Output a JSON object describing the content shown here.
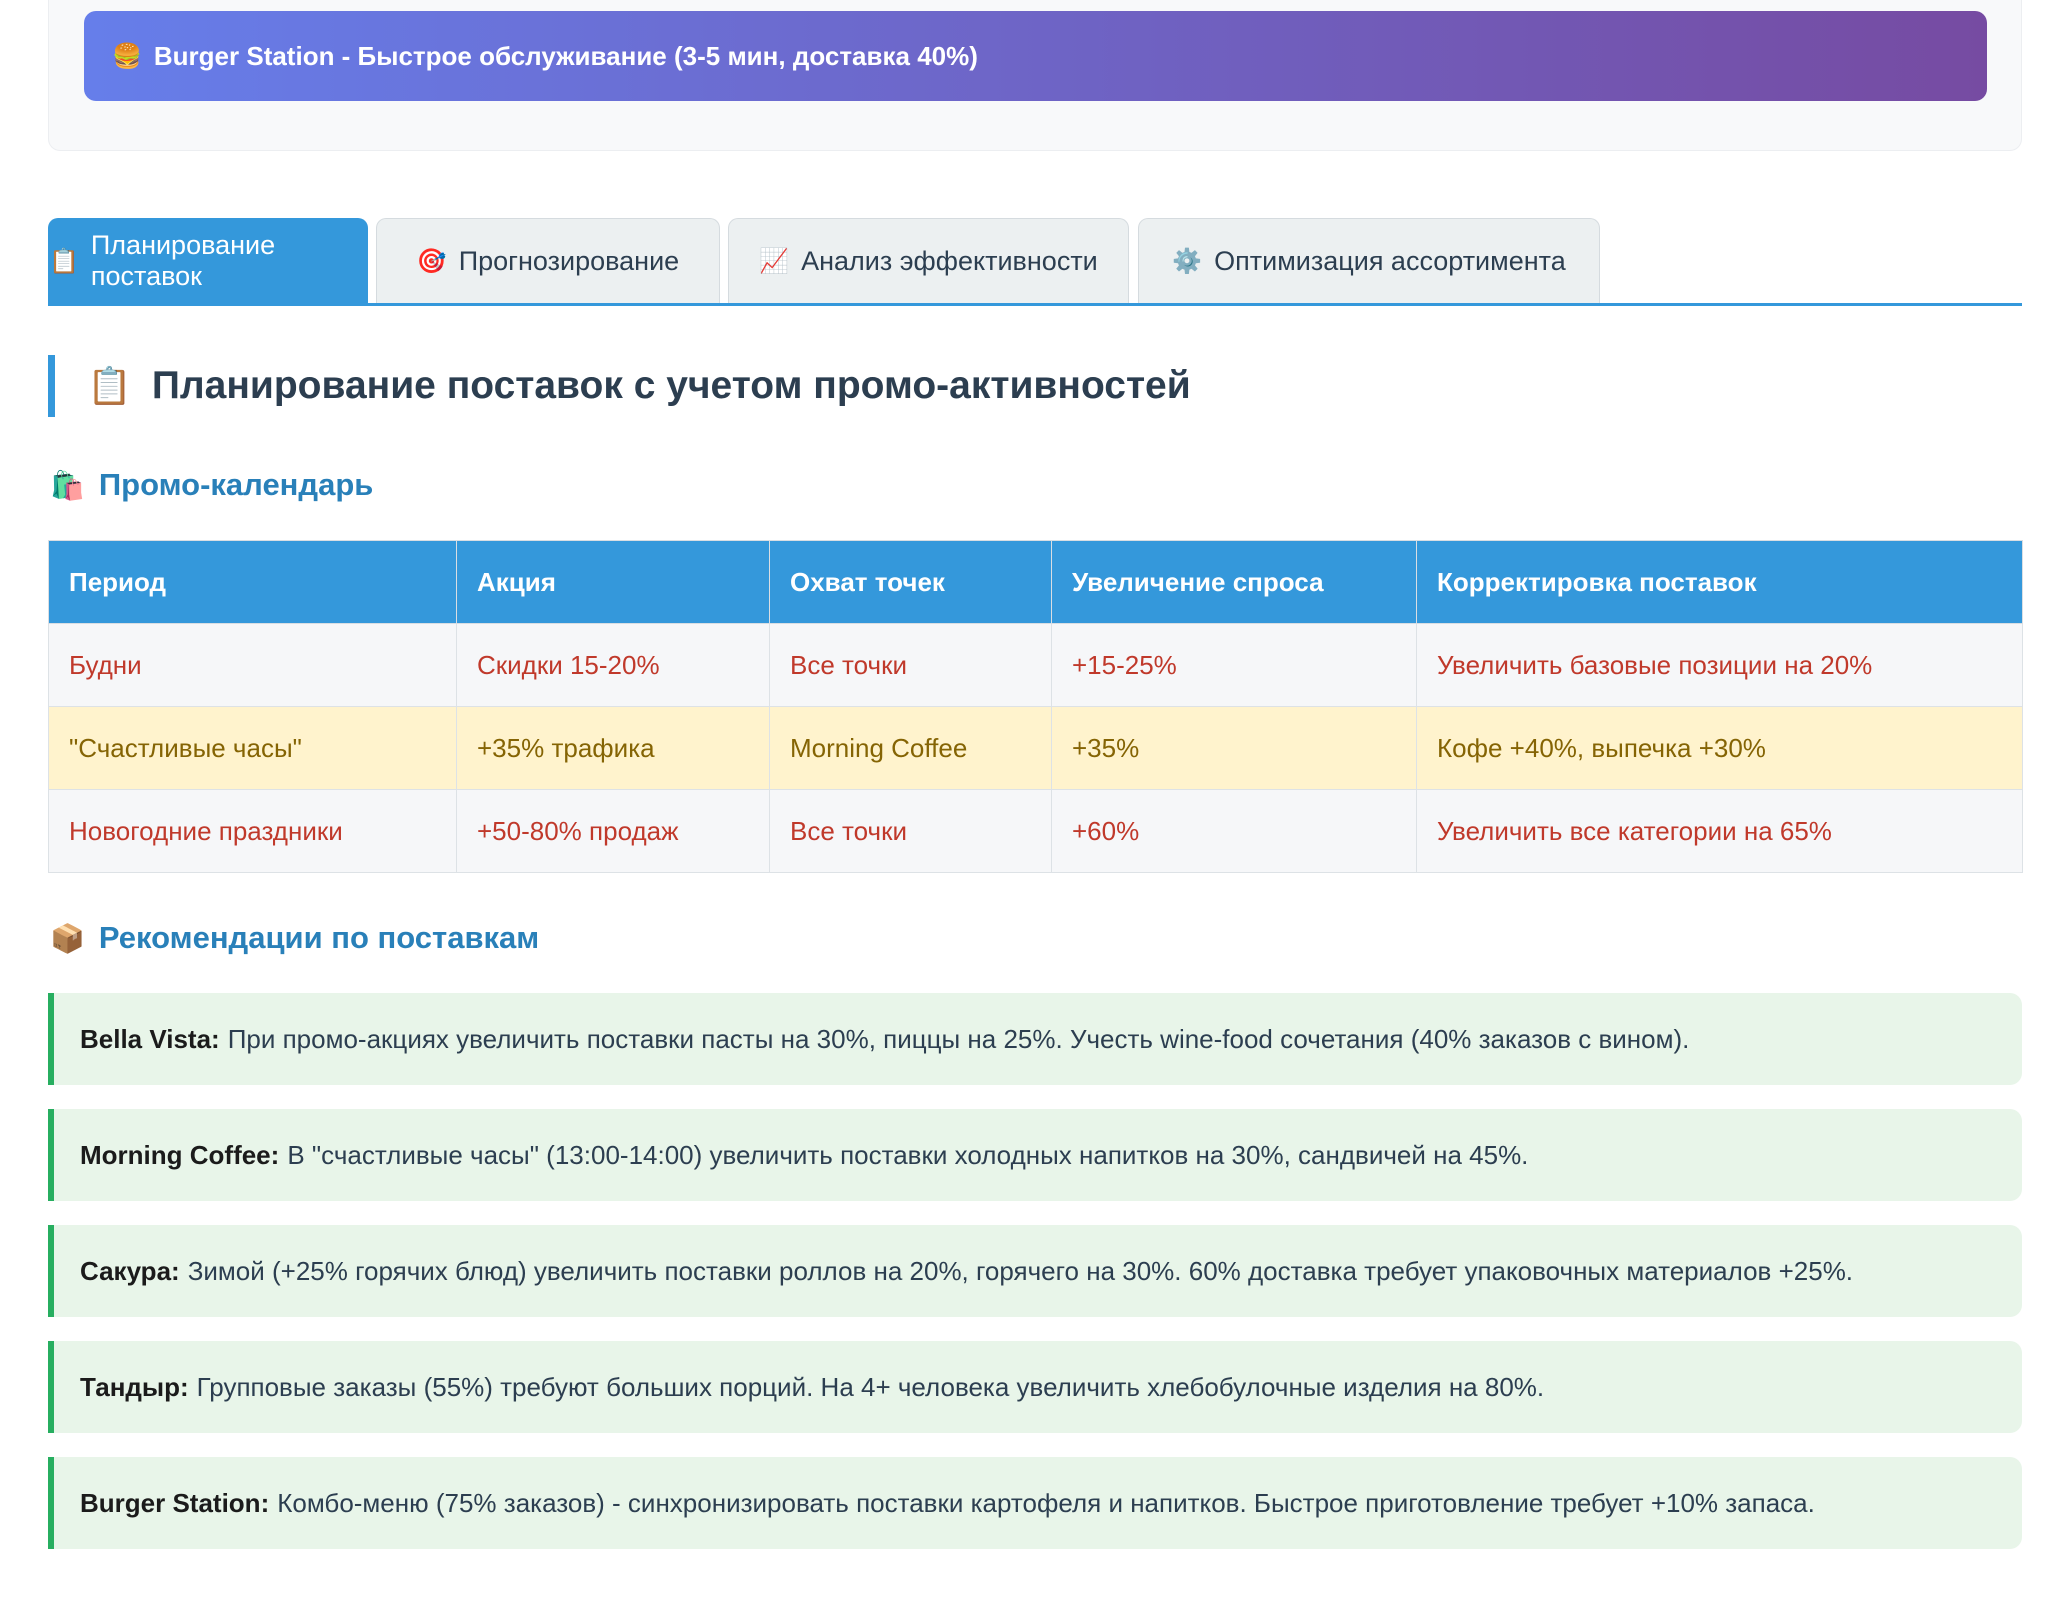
{
  "banner": {
    "emoji": "🍔",
    "text": "Burger Station - Быстрое обслуживание (3-5 мин, доставка 40%)"
  },
  "tabs": [
    {
      "icon": "📋",
      "label": "Планирование поставок",
      "active": true
    },
    {
      "icon": "🎯",
      "label": "Прогнозирование",
      "active": false
    },
    {
      "icon": "📈",
      "label": "Анализ эффективности",
      "active": false
    },
    {
      "icon": "⚙️",
      "label": "Оптимизация ассортимента",
      "active": false
    }
  ],
  "section": {
    "emoji": "📋",
    "title": "Планирование поставок с учетом промо-активностей"
  },
  "promo_calendar": {
    "emoji": "🛍️",
    "title": "Промо-календарь",
    "columns": [
      "Период",
      "Акция",
      "Охват точек",
      "Увеличение спроса",
      "Корректировка поставок"
    ],
    "rows": [
      {
        "period": "Будни",
        "action": "Скидки 15-20%",
        "coverage": "Все точки",
        "demand": "+15-25%",
        "adjustment": "Увеличить базовые позиции на 20%"
      },
      {
        "period": "\"Счастливые часы\"",
        "action": "+35% трафика",
        "coverage": "Morning Coffee",
        "demand": "+35%",
        "adjustment": "Кофе +40%, выпечка +30%"
      },
      {
        "period": "Новогодние праздники",
        "action": "+50-80% продаж",
        "coverage": "Все точки",
        "demand": "+60%",
        "adjustment": "Увеличить все категории на 65%"
      }
    ]
  },
  "recommendations": {
    "emoji": "📦",
    "title": "Рекомендации по поставкам",
    "items": [
      {
        "name": "Bella Vista:",
        "text": "При промо-акциях увеличить поставки пасты на 30%, пиццы на 25%. Учесть wine-food сочетания (40% заказов с вином)."
      },
      {
        "name": "Morning Coffee:",
        "text": "В \"счастливые часы\" (13:00-14:00) увеличить поставки холодных напитков на 30%, сандвичей на 45%."
      },
      {
        "name": "Сакура:",
        "text": "Зимой (+25% горячих блюд) увеличить поставки роллов на 20%, горячего на 30%. 60% доставка требует упаковочных материалов +25%."
      },
      {
        "name": "Тандыр:",
        "text": "Групповые заказы (55%) требуют больших порций. На 4+ человека увеличить хлебобулочные изделия на 80%."
      },
      {
        "name": "Burger Station:",
        "text": "Комбо-меню (75% заказов) - синхронизировать поставки картофеля и напитков. Быстрое приготовление требует +10% запаса."
      }
    ]
  },
  "colors": {
    "accent": "#3498db",
    "banner_gradient_start": "#667eea",
    "banner_gradient_end": "#764ba2",
    "highlight_row": "#fff3cd",
    "recommendation_bg": "#e8f5e9",
    "recommendation_border": "#27ae60"
  }
}
